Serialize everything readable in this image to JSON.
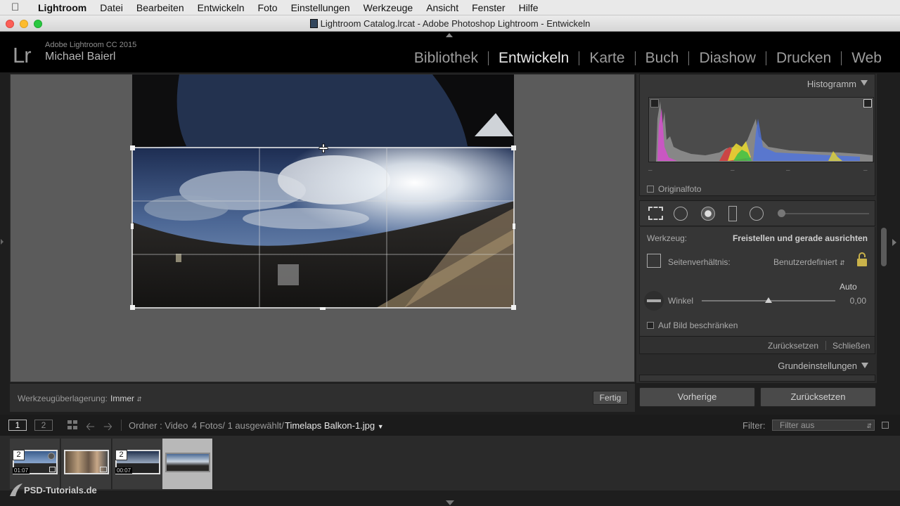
{
  "menubar": {
    "app": "Lightroom",
    "items": [
      "Datei",
      "Bearbeiten",
      "Entwickeln",
      "Foto",
      "Einstellungen",
      "Werkzeuge",
      "Ansicht",
      "Fenster",
      "Hilfe"
    ]
  },
  "window": {
    "title": "Lightroom Catalog.lrcat - Adobe Photoshop Lightroom - Entwickeln"
  },
  "header": {
    "logo": "Lr",
    "version": "Adobe Lightroom CC 2015",
    "user": "Michael Baierl",
    "modules": [
      "Bibliothek",
      "Entwickeln",
      "Karte",
      "Buch",
      "Diashow",
      "Drucken",
      "Web"
    ],
    "active_module": "Entwickeln"
  },
  "toolbar": {
    "overlay_label": "Werkzeugüberlagerung:",
    "overlay_value": "Immer",
    "done_label": "Fertig"
  },
  "histogram": {
    "title": "Histogramm",
    "original_label": "Originalfoto",
    "dashes": [
      "–",
      "–",
      "–",
      "–"
    ]
  },
  "crop": {
    "tool_label": "Werkzeug:",
    "tool_value": "Freistellen und gerade ausrichten",
    "aspect_label": "Seitenverhältnis:",
    "aspect_value": "Benutzerdefiniert",
    "auto_label": "Auto",
    "angle_label": "Winkel",
    "angle_value": "0,00",
    "angle_fraction": 0.5,
    "constrain_label": "Auf Bild beschränken",
    "reset_label": "Zurücksetzen",
    "close_label": "Schließen"
  },
  "basic_panel": {
    "title": "Grundeinstellungen"
  },
  "bottom_buttons": {
    "previous": "Vorherige",
    "reset": "Zurücksetzen"
  },
  "filmbar": {
    "view1": "1",
    "view2": "2",
    "source": "Ordner : Video",
    "count": "4 Fotos/ 1 ausgewählt/",
    "filename": "Timelaps Balkon-1.jpg",
    "filter_label": "Filter:",
    "filter_value": "Filter aus"
  },
  "filmstrip": {
    "items": [
      {
        "badge": "2",
        "duration": "01:07"
      },
      {
        "badge": "",
        "duration": ""
      },
      {
        "badge": "2",
        "duration": "00:07"
      },
      {
        "badge": "",
        "duration": ""
      }
    ]
  },
  "watermark": "PSD-Tutorials.de"
}
